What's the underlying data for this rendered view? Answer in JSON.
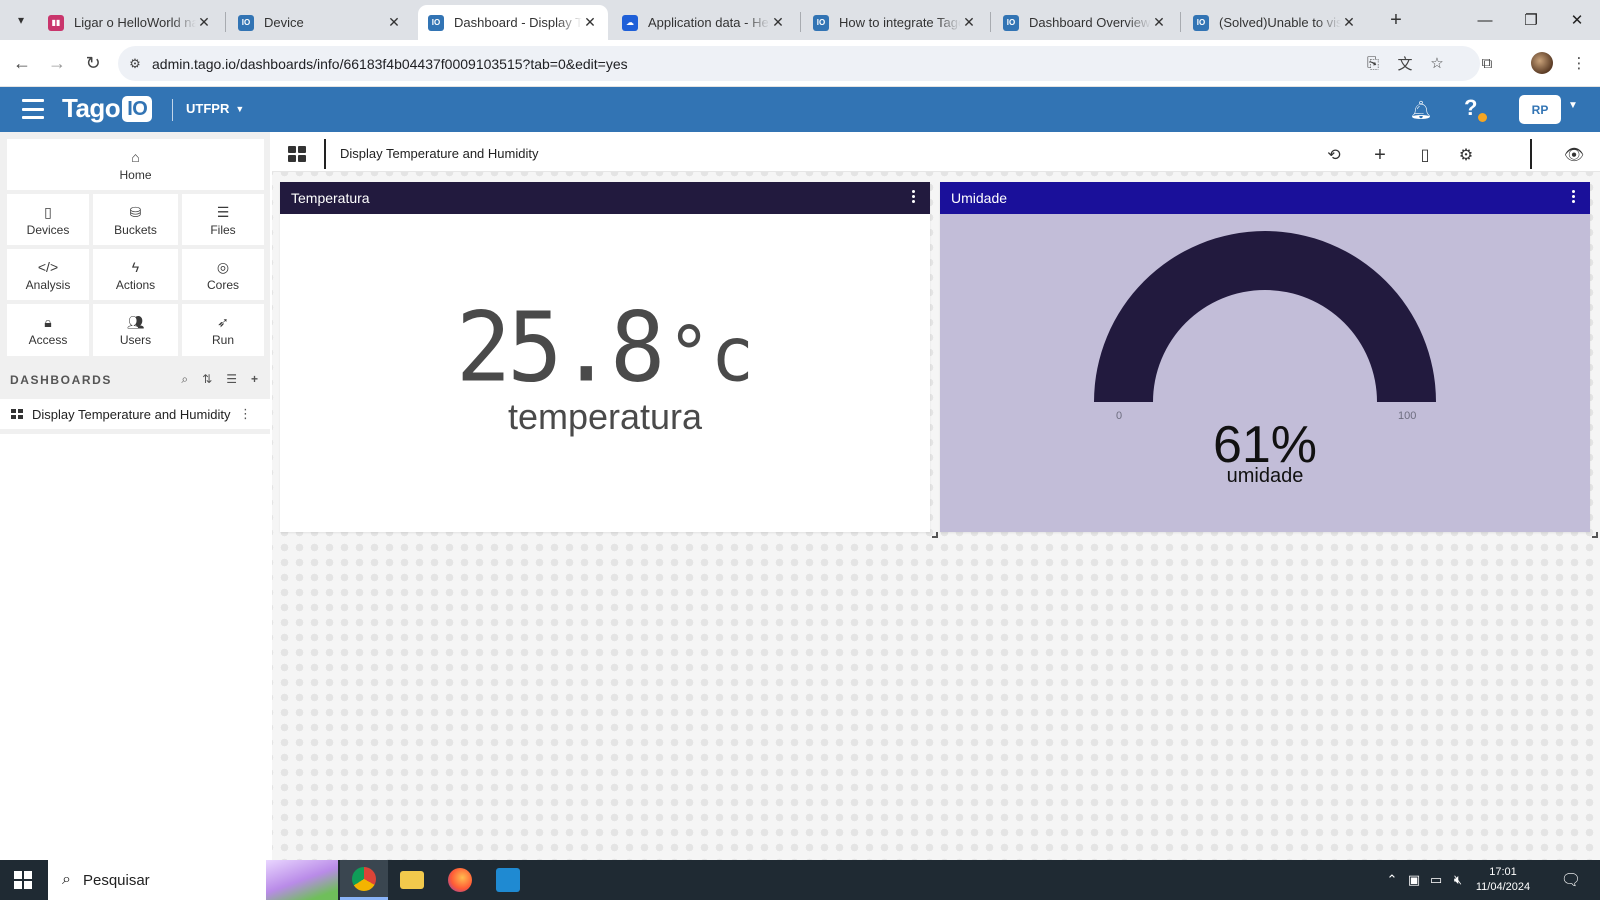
{
  "browser": {
    "tabs": [
      {
        "title": "Ligar o HelloWorld na TagoIO",
        "favicon": "trello-icon",
        "color": "#c9356c",
        "active": false
      },
      {
        "title": "Device",
        "favicon": "tagoio-icon",
        "color": "#3274b4",
        "active": false
      },
      {
        "title": "Dashboard - Display Temperature",
        "favicon": "tagoio-icon",
        "color": "#3274b4",
        "active": true
      },
      {
        "title": "Application data - HelloWorld",
        "favicon": "ttn-icon",
        "color": "#1e5fd8",
        "active": false
      },
      {
        "title": "How to integrate TagoIO",
        "favicon": "tagoio-icon",
        "color": "#3274b4",
        "active": false
      },
      {
        "title": "Dashboard Overview",
        "favicon": "tagoio-icon",
        "color": "#3274b4",
        "active": false
      },
      {
        "title": "(Solved)Unable to visualize",
        "favicon": "tagoio-icon",
        "color": "#3274b4",
        "active": false
      }
    ],
    "url": "admin.tago.io/dashboards/info/66183f4b04437f0009103515?tab=0&edit=yes"
  },
  "header": {
    "logo_text": "Tago",
    "logo_badge": "IO",
    "account": "UTFPR",
    "avatar_initials": "RP",
    "notification_dot_color": "#f5a623"
  },
  "sidebar": {
    "nav": [
      {
        "label": "Home",
        "icon": "home-icon"
      },
      {
        "label": "Devices",
        "icon": "device-icon"
      },
      {
        "label": "Buckets",
        "icon": "bucket-icon"
      },
      {
        "label": "Files",
        "icon": "files-icon"
      },
      {
        "label": "Analysis",
        "icon": "code-icon"
      },
      {
        "label": "Actions",
        "icon": "lightning-icon"
      },
      {
        "label": "Cores",
        "icon": "palette-icon"
      },
      {
        "label": "Access",
        "icon": "lock-icon"
      },
      {
        "label": "Users",
        "icon": "users-icon"
      },
      {
        "label": "Run",
        "icon": "rocket-icon"
      }
    ],
    "dashboards_heading": "DASHBOARDS",
    "dashboards": [
      {
        "name": "Display Temperature and Humidity"
      }
    ]
  },
  "dashboard": {
    "title": "Display Temperature and Humidity"
  },
  "widgets": {
    "temperature": {
      "title": "Temperatura",
      "value": "25.8",
      "unit": "°c",
      "label": "temperatura",
      "header_color": "#221a3e"
    },
    "humidity": {
      "title": "Umidade",
      "value": 61,
      "value_text": "61%",
      "label": "umidade",
      "min": "0",
      "max": "100",
      "header_color": "#1a109a",
      "background_color": "#c2bdd8",
      "arc_color": "#221a3e"
    }
  },
  "taskbar": {
    "search_placeholder": "Pesquisar",
    "time": "17:01",
    "date": "11/04/2024"
  }
}
